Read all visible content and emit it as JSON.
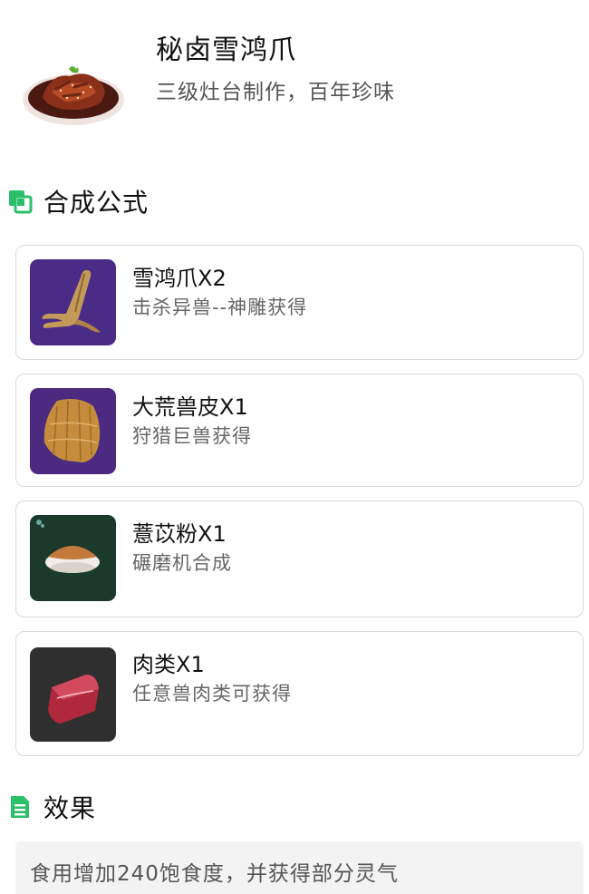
{
  "dish": {
    "name": "秘卤雪鸿爪",
    "subtitle": "三级灶台制作，百年珍味",
    "image": "braised-claw-dish-icon"
  },
  "formula_section": {
    "title": "合成公式",
    "icon": "copy-squares-icon",
    "accent": "#2bbf6a"
  },
  "ingredients": [
    {
      "name": "雪鸿爪X2",
      "source": "击杀异兽--神雕获得",
      "icon": "bird-claw-icon",
      "bg": "#4a2c86"
    },
    {
      "name": "大荒兽皮X1",
      "source": "狩猎巨兽获得",
      "icon": "beast-hide-icon",
      "bg": "#4b2a80"
    },
    {
      "name": "薏苡粉X1",
      "source": "碾磨机合成",
      "icon": "powder-bowl-icon",
      "bg": "#1c3a2c"
    },
    {
      "name": "肉类X1",
      "source": "任意兽肉类可获得",
      "icon": "raw-meat-icon",
      "bg": "#2f2f2f"
    }
  ],
  "effect_section": {
    "title": "效果",
    "icon": "document-icon",
    "text": "食用增加240饱食度，并获得部分灵气"
  }
}
